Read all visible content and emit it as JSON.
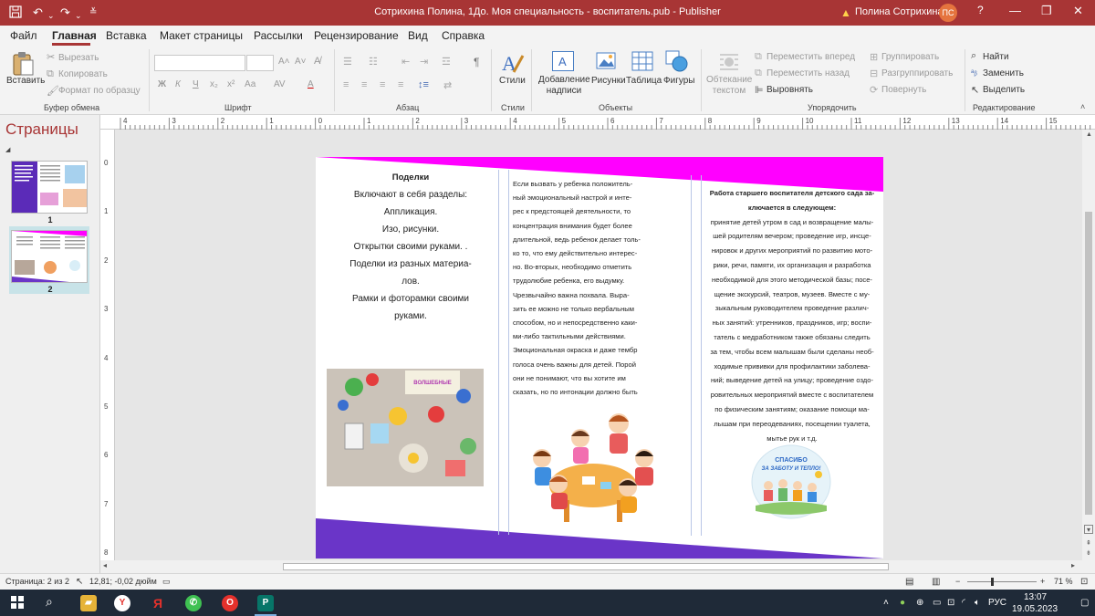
{
  "window": {
    "title": "Сотрихина Полина, 1До. Моя специальность - воспитатель.pub  -  Publisher",
    "user": "Полина Сотрихина",
    "avatar_initials": "ПС",
    "help": "?",
    "colors": {
      "accent": "#a83535",
      "magenta": "#ff00ff",
      "purple": "#6a35c8"
    }
  },
  "menu": {
    "tabs": [
      "Файл",
      "Главная",
      "Вставка",
      "Макет страницы",
      "Рассылки",
      "Рецензирование",
      "Вид",
      "Справка"
    ],
    "active": "Главная"
  },
  "ribbon": {
    "clipboard": {
      "paste": "Вставить",
      "cut": "Вырезать",
      "copy": "Копировать",
      "format_painter": "Формат по образцу",
      "label": "Буфер обмена"
    },
    "font": {
      "bold": "Ж",
      "italic": "К",
      "underline": "Ч",
      "subscript": "x₂",
      "superscript": "x²",
      "change_case": "Аа",
      "spacing": "AV",
      "color": "А",
      "grow": "A˄",
      "shrink": "A˅",
      "label": "Шрифт"
    },
    "paragraph": {
      "label": "Абзац",
      "pilcrow": "¶"
    },
    "styles": {
      "button": "Стили",
      "label": "Стили"
    },
    "objects": {
      "textbox": "Добавление надписи",
      "pictures": "Рисунки",
      "table": "Таблица",
      "shapes": "Фигуры",
      "label": "Объекты"
    },
    "arrange": {
      "wrap": "Обтекание текстом",
      "forward": "Переместить вперед",
      "backward": "Переместить назад",
      "align": "Выровнять",
      "group": "Группировать",
      "ungroup": "Разгруппировать",
      "rotate": "Повернуть",
      "label": "Упорядочить"
    },
    "editing": {
      "find": "Найти",
      "replace": "Заменить",
      "select": "Выделить",
      "label": "Редактирование"
    }
  },
  "pages_pane": {
    "title": "Страницы",
    "thumbs": [
      {
        "num": "1"
      },
      {
        "num": "2"
      }
    ]
  },
  "ruler": {
    "h_numbers": [
      "4",
      "3",
      "2",
      "1",
      "0",
      "1",
      "2",
      "3",
      "4",
      "5",
      "6",
      "7",
      "8",
      "9",
      "10",
      "11",
      "12",
      "13",
      "14",
      "15"
    ],
    "v_numbers": [
      "0",
      "1",
      "2",
      "3",
      "4",
      "5",
      "6",
      "7",
      "8"
    ]
  },
  "document": {
    "col1": {
      "heading": "Поделки",
      "lines": [
        "Включают в себя разделы:",
        "Аппликация.",
        "Изо, рисунки.",
        "Открытки своими руками. .",
        "Поделки из разных материа-",
        "лов.",
        "Рамки и фоторамки своими",
        "руками."
      ]
    },
    "col2": {
      "lines": [
        "Если вызвать у ребенка положитель-",
        "ный эмоциональный настрой и инте-",
        "рес к предстоящей деятельности, то",
        "концентрация внимания будет более",
        "длительной, ведь ребенок делает толь-",
        "ко то, что ему действительно интерес-",
        "но. Во-вторых, необходимо отметить",
        "трудолюбие ребенка, его выдумку.",
        "Чрезвычайно важна похвала. Выра-",
        "зить ее можно не только вербальным",
        "способом, но и непосредственно каки-",
        "ми-либо тактильными действиями.",
        "Эмоциональная окраска и даже тембр",
        "голоса очень важны для детей. Порой",
        "они не понимают, что вы хотите им",
        "сказать, но по интонации должно быть"
      ]
    },
    "col3": {
      "heading": [
        "Работа старшего воспитателя детского сада за-",
        "ключается в следующем:"
      ],
      "lines": [
        "принятие детей утром в сад и возвращение малы-",
        "шей родителям вечером; проведение игр, инсце-",
        "нировок и других мероприятий по развитию мото-",
        "рики, речи, памяти, их организация и разработка",
        "необходимой для этого методической базы; посе-",
        "щение экскурсий, театров, музеев. Вместе с му-",
        "зыкальным руководителем проведение различ-",
        "ных занятий: утренников, праздников, игр; воспи-",
        "татель с медработником также обязаны следить",
        "за тем, чтобы всем малышам были сделаны необ-",
        "ходимые прививки для профилактики заболева-",
        "ний; выведение детей на улицу; проведение оздо-",
        "ровительных мероприятий вместе с воспитателем",
        "по физическим занятиям; оказание помощи ма-",
        "лышам при переодеваниях, посещении туалета,",
        "мытье рук и т.д."
      ],
      "thanks": [
        "СПАСИБО",
        "ЗА ЗАБОТУ И ТЕПЛО!"
      ]
    },
    "craft_label": "ВОЛШЕБНЫЕ"
  },
  "status": {
    "page": "Страница: 2 из 2",
    "coords": "12,81; -0,02 дюйм",
    "zoom": "71 %",
    "zoom_level": 0.71
  },
  "taskbar": {
    "lang": "РУС",
    "time": "13:07",
    "date": "19.05.2023"
  }
}
